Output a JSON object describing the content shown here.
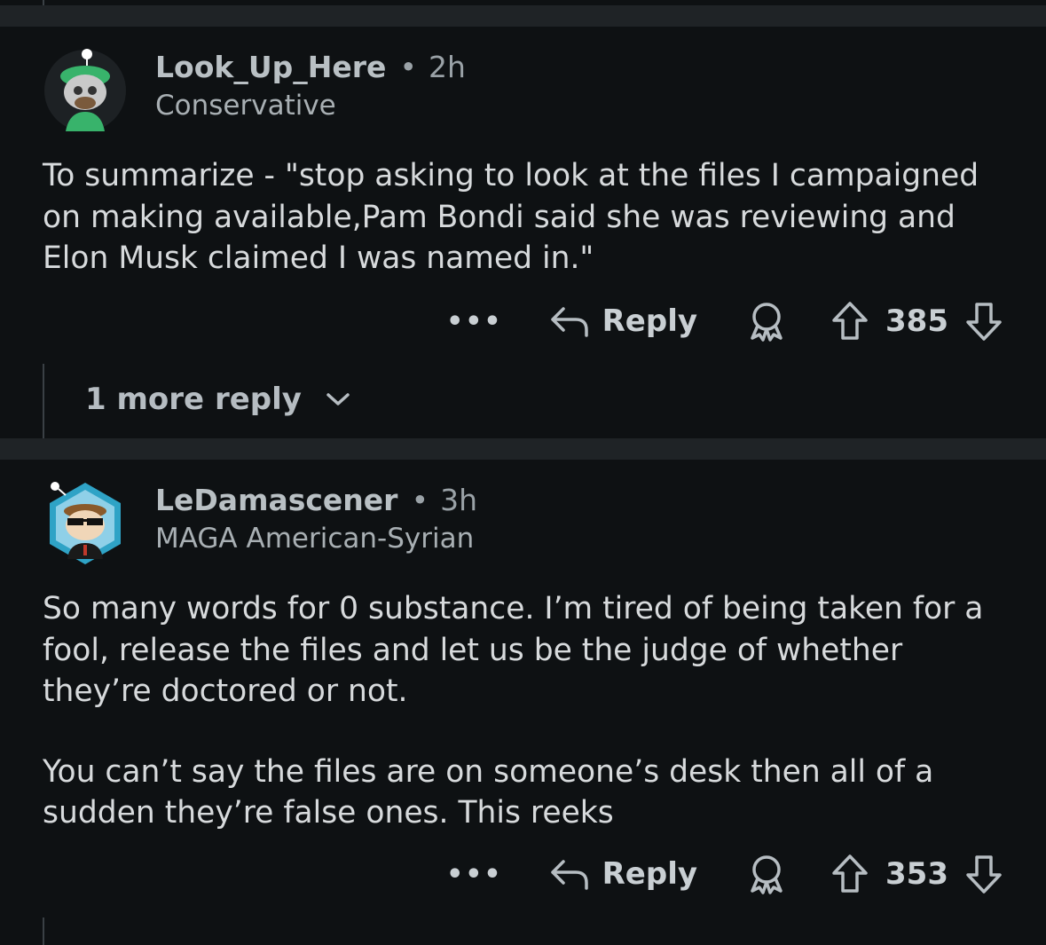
{
  "comments": [
    {
      "username": "Look_Up_Here",
      "separator": "•",
      "age": "2h",
      "flair": "Conservative",
      "paragraphs": [
        "To summarize - \"stop asking to look at the files I campaigned on making available,Pam Bondi said she was reviewing and Elon Musk claimed I was named in.\""
      ],
      "actions": {
        "more": "•••",
        "reply": "Reply",
        "score": "385"
      },
      "more_replies": "1 more reply"
    },
    {
      "username": "LeDamascener",
      "separator": "•",
      "age": "3h",
      "flair": "MAGA American-Syrian",
      "paragraphs": [
        "So many words for 0 substance. I’m tired of being taken for a fool, release the files and let us be the judge of whether they’re doctored or not.",
        "You can’t say the files are on someone’s desk then all of a sudden they’re false ones. This reeks"
      ],
      "actions": {
        "more": "•••",
        "reply": "Reply",
        "score": "353"
      }
    }
  ],
  "icons": [
    "reply-arrow-icon",
    "award-icon",
    "upvote-icon",
    "downvote-icon",
    "chevron-down-icon",
    "more-options-icon"
  ],
  "colors": {
    "background": "#0e1113",
    "separator": "#1f2326",
    "text": "#d7dadc",
    "meta": "#9aa2a7"
  }
}
